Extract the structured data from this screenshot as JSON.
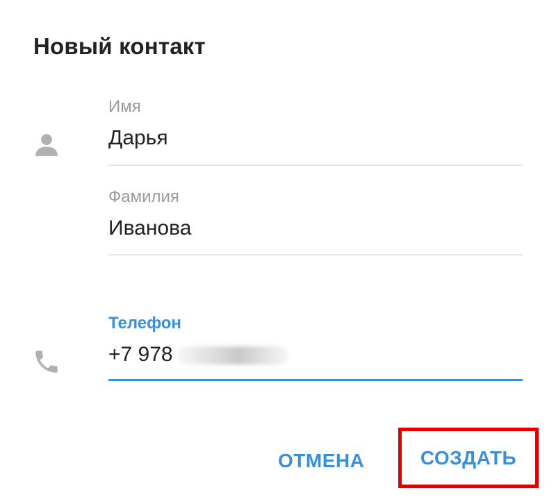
{
  "dialog": {
    "title": "Новый контакт",
    "fields": {
      "first_name": {
        "label": "Имя",
        "value": "Дарья"
      },
      "last_name": {
        "label": "Фамилия",
        "value": "Иванова"
      },
      "phone": {
        "label": "Телефон",
        "value": "+7 978"
      }
    },
    "buttons": {
      "cancel": "ОТМЕНА",
      "create": "СОЗДАТЬ"
    },
    "icons": {
      "name_field": "person-icon",
      "phone_field": "phone-icon"
    },
    "colors": {
      "accent": "#3a8fd6",
      "highlight": "#e00000",
      "icon": "#b0b0b0"
    }
  }
}
